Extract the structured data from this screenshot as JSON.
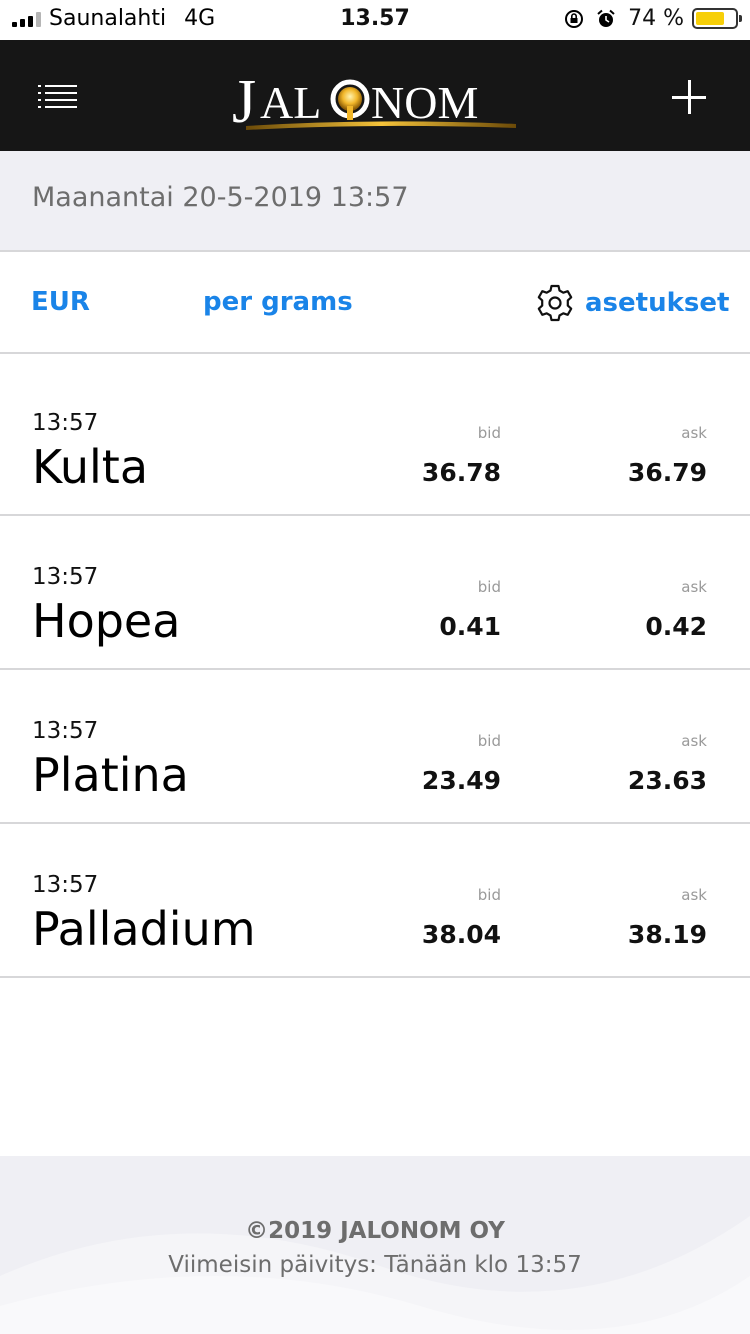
{
  "status_bar": {
    "carrier": "Saunalahti",
    "network": "4G",
    "time": "13.57",
    "battery_percent": "74 %",
    "battery_level": 0.74,
    "battery_color": "#f7cf08",
    "icons": [
      "signal-icon",
      "orientation-lock-icon",
      "alarm-icon",
      "battery-icon"
    ]
  },
  "header": {
    "logo_text": "JALONOM",
    "menu_icon": "menu-icon",
    "add_icon": "plus-icon",
    "logo_accent": "#e3a51a"
  },
  "date_bar": {
    "text": "Maanantai 20-5-2019 13:57"
  },
  "options": {
    "currency": "EUR",
    "unit": "per grams",
    "settings_label": "asetukset",
    "accent": "#1a84e8"
  },
  "metals": [
    {
      "time": "13:57",
      "name": "Kulta",
      "bid_label": "bid",
      "ask_label": "ask",
      "bid": "36.78",
      "ask": "36.79"
    },
    {
      "time": "13:57",
      "name": "Hopea",
      "bid_label": "bid",
      "ask_label": "ask",
      "bid": "0.41",
      "ask": "0.42"
    },
    {
      "time": "13:57",
      "name": "Platina",
      "bid_label": "bid",
      "ask_label": "ask",
      "bid": "23.49",
      "ask": "23.63"
    },
    {
      "time": "13:57",
      "name": "Palladium",
      "bid_label": "bid",
      "ask_label": "ask",
      "bid": "38.04",
      "ask": "38.19"
    }
  ],
  "footer": {
    "copyright": "©2019 JALONOM OY",
    "updated": "Viimeisin päivitys: Tänään klo 13:57"
  }
}
